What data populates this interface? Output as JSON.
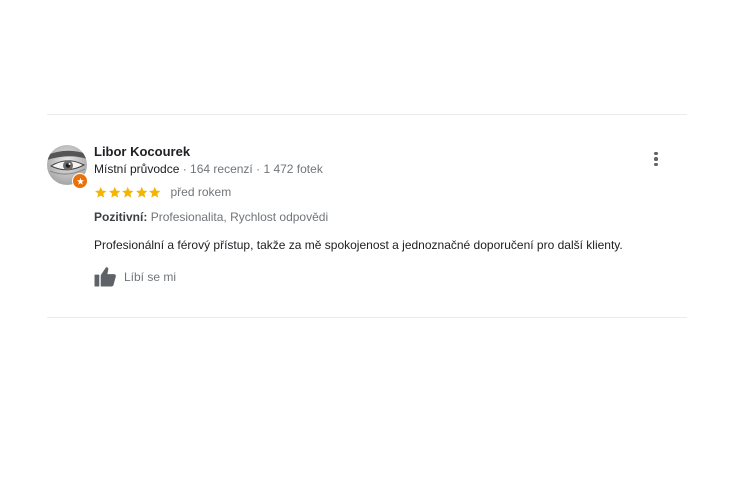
{
  "review": {
    "author": {
      "name": "Libor Kocourek",
      "role": "Místní průvodce",
      "reviews_count": "164 recenzí",
      "photos_count": "1 472 fotek",
      "separator": " · "
    },
    "rating": {
      "stars": 5,
      "max": 5,
      "color": "#f4b400"
    },
    "time": "před rokem",
    "attributes": {
      "label": "Pozitivní:",
      "value": "Profesionalita, Rychlost odpovědi"
    },
    "text": "Profesionální a férový přístup, takže za mě spokojenost a jednoznačné doporučení pro další klienty.",
    "like_label": "Líbí se mi",
    "icons": {
      "more": "more-vert-icon",
      "like": "thumb-up-icon",
      "badge": "local-guide-badge-icon"
    }
  },
  "colors": {
    "badge": "#e8710a",
    "star": "#f4b400",
    "text_secondary": "#70757a"
  }
}
